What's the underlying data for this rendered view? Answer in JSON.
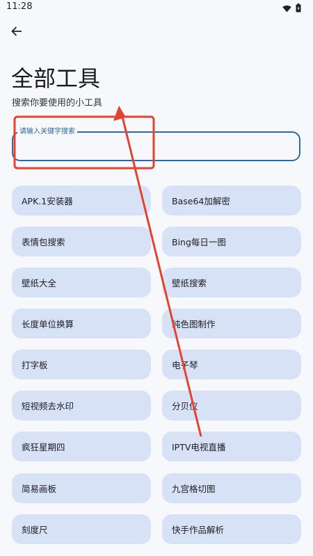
{
  "status_bar": {
    "time": "11:28",
    "icons": [
      "wifi-icon",
      "battery-icon"
    ]
  },
  "header": {
    "back_icon": "arrow-left-icon",
    "title": "全部工具",
    "subtitle": "搜索你要使用的小工具"
  },
  "search": {
    "label": "请输入关键字搜索",
    "value": "",
    "placeholder": ""
  },
  "tools": [
    {
      "left": "APK.1安装器",
      "right": "Base64加解密"
    },
    {
      "left": "表情包搜索",
      "right": "Bing每日一图"
    },
    {
      "left": "壁纸大全",
      "right": "壁纸搜索"
    },
    {
      "left": "长度单位换算",
      "right": "纯色图制作"
    },
    {
      "left": "打字板",
      "right": "电子琴"
    },
    {
      "left": "短视频去水印",
      "right": "分贝仪"
    },
    {
      "left": "疯狂星期四",
      "right": "IPTV电视直播"
    },
    {
      "left": "简易画板",
      "right": "九宫格切图"
    },
    {
      "left": "刻度尺",
      "right": "快手作品解析"
    }
  ],
  "colors": {
    "accent": "#2c6aa6",
    "tool_bg": "#d8e2f7",
    "annotation": "#e5432e"
  }
}
